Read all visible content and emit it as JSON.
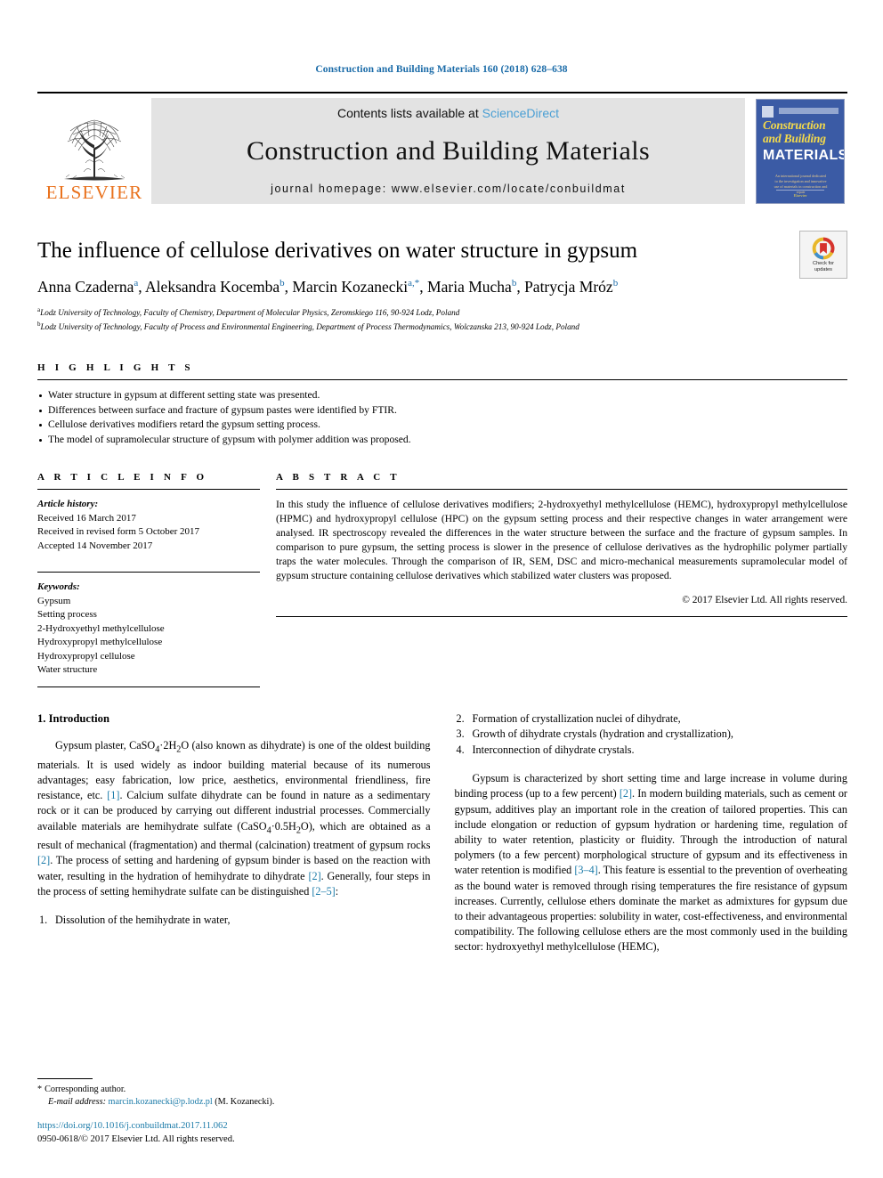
{
  "running_head": "Construction and Building Materials 160 (2018) 628–638",
  "masthead": {
    "contents_prefix": "Contents lists available at ",
    "sciencedirect": "ScienceDirect",
    "journal_title": "Construction and Building Materials",
    "homepage": "journal homepage: www.elsevier.com/locate/conbuildmat",
    "publisher": "ELSEVIER",
    "cover": {
      "line1": "Construction",
      "line2": "and Building",
      "line3": "MATERIALS",
      "blurb": "An international journal dedicated to the investigation and innovative use of materials in construction and repair",
      "foot": "Elsevier"
    }
  },
  "article": {
    "title": "The influence of cellulose derivatives on water structure in gypsum",
    "authors": [
      {
        "name": "Anna Czaderna",
        "sup": "a"
      },
      {
        "name": "Aleksandra Kocemba",
        "sup": "b"
      },
      {
        "name": "Marcin Kozanecki",
        "sup": "a,*"
      },
      {
        "name": "Maria Mucha",
        "sup": "b"
      },
      {
        "name": "Patrycja Mróz",
        "sup": "b"
      }
    ],
    "affiliations": [
      {
        "mark": "a",
        "text": "Lodz University of Technology, Faculty of Chemistry, Department of Molecular Physics, Zeromskiego 116, 90-924 Lodz, Poland"
      },
      {
        "mark": "b",
        "text": "Lodz University of Technology, Faculty of Process and Environmental Engineering, Department of Process Thermodynamics, Wolczanska 213, 90-924 Lodz, Poland"
      }
    ],
    "crossmark_label": "Check for\nupdates"
  },
  "highlights": {
    "label": "H I G H L I G H T S",
    "items": [
      "Water structure in gypsum at different setting state was presented.",
      "Differences between surface and fracture of gypsum pastes were identified by FTIR.",
      "Cellulose derivatives modifiers retard the gypsum setting process.",
      "The model of supramolecular structure of gypsum with polymer addition was proposed."
    ]
  },
  "article_info": {
    "label": "A R T I C L E    I N F O",
    "history_label": "Article history:",
    "history": [
      "Received 16 March 2017",
      "Received in revised form 5 October 2017",
      "Accepted 14 November 2017"
    ],
    "keywords_label": "Keywords:",
    "keywords": [
      "Gypsum",
      "Setting process",
      "2-Hydroxyethyl methylcellulose",
      "Hydroxypropyl methylcellulose",
      "Hydroxypropyl cellulose",
      "Water structure"
    ]
  },
  "abstract": {
    "label": "A B S T R A C T",
    "text": "In this study the influence of cellulose derivatives modifiers; 2-hydroxyethyl methylcellulose (HEMC), hydroxypropyl methylcellulose (HPMC) and hydroxypropyl cellulose (HPC) on the gypsum setting process and their respective changes in water arrangement were analysed. IR spectroscopy revealed the differences in the water structure between the surface and the fracture of gypsum samples. In comparison to pure gypsum, the setting process is slower in the presence of cellulose derivatives as the hydrophilic polymer partially traps the water molecules. Through the comparison of IR, SEM, DSC and micro-mechanical measurements supramolecular model of gypsum structure containing cellulose derivatives which stabilized water clusters was proposed.",
    "copyright": "© 2017 Elsevier Ltd. All rights reserved."
  },
  "body": {
    "section_heading": "1. Introduction",
    "left_paragraph_1_pre": "Gypsum plaster, CaSO",
    "left_paragraph_1": {
      "seg1": "Gypsum plaster, CaSO",
      "sub1": "4",
      "seg2": "·2H",
      "sub2": "2",
      "seg3": "O (also known as dihydrate) is one of the oldest building materials. It is used widely as indoor building material because of its numerous advantages; easy fabrication, low price, aesthetics, environmental friendliness, fire resistance, etc. ",
      "ref1": "[1]",
      "seg4": ". Calcium sulfate dihydrate can be found in nature as a sedimentary rock or it can be produced by carrying out different industrial processes. Commercially available materials are hemihydrate sulfate (CaSO",
      "sub3": "4",
      "seg5": "·0.5H",
      "sub4": "2",
      "seg6": "O), which are obtained as a result of mechanical (fragmentation) and thermal (calcination) treatment of gypsum rocks ",
      "ref2": "[2]",
      "seg7": ". The process of setting and hardening of gypsum binder is based on the reaction with water, resulting in the hydration of hemihydrate to dihydrate ",
      "ref3": "[2]",
      "seg8": ". Generally, four steps in the process of setting hemihydrate sulfate can be distinguished ",
      "ref4": "[2–5]",
      "seg9": ":"
    },
    "steps": [
      {
        "num": "1.",
        "text": "Dissolution of the hemihydrate in water,"
      },
      {
        "num": "2.",
        "text": "Formation of crystallization nuclei of dihydrate,"
      },
      {
        "num": "3.",
        "text": "Growth of dihydrate crystals (hydration and crystallization),"
      },
      {
        "num": "4.",
        "text": "Interconnection of dihydrate crystals."
      }
    ],
    "right_paragraph": {
      "seg1": "Gypsum is characterized by short setting time and large increase in volume during binding process (up to a few percent) ",
      "ref1": "[2]",
      "seg2": ". In modern building materials, such as cement or gypsum, additives play an important role in the creation of tailored properties. This can include elongation or reduction of gypsum hydration or hardening time, regulation of ability to water retention, plasticity or fluidity. Through the introduction of natural polymers (to a few percent) morphological structure of gypsum and its effectiveness in water retention is modified ",
      "ref2": "[3–4]",
      "seg3": ". This feature is essential to the prevention of overheating as the bound water is removed through rising temperatures the fire resistance of gypsum increases. Currently, cellulose ethers dominate the market as admixtures for gypsum due to their advantageous properties: solubility in water, cost-effectiveness, and environmental compatibility. The following cellulose ethers are the most commonly used in the building sector: hydroxyethyl methylcellulose (HEMC),"
    }
  },
  "footer": {
    "corresponding_star": "*",
    "corresponding_label": "Corresponding author.",
    "email_label": "E-mail address:",
    "email": "marcin.kozanecki@p.lodz.pl",
    "email_suffix": "(M. Kozanecki).",
    "doi": "https://doi.org/10.1016/j.conbuildmat.2017.11.062",
    "issn_line": "0950-0618/© 2017 Elsevier Ltd. All rights reserved."
  },
  "colors": {
    "link_blue": "#1a7aa8",
    "sciencedirect_blue": "#4a9fd4",
    "elsevier_orange": "#E9711C",
    "cover_blue": "#3b5ba5",
    "cover_yellow": "#f3d94b"
  }
}
